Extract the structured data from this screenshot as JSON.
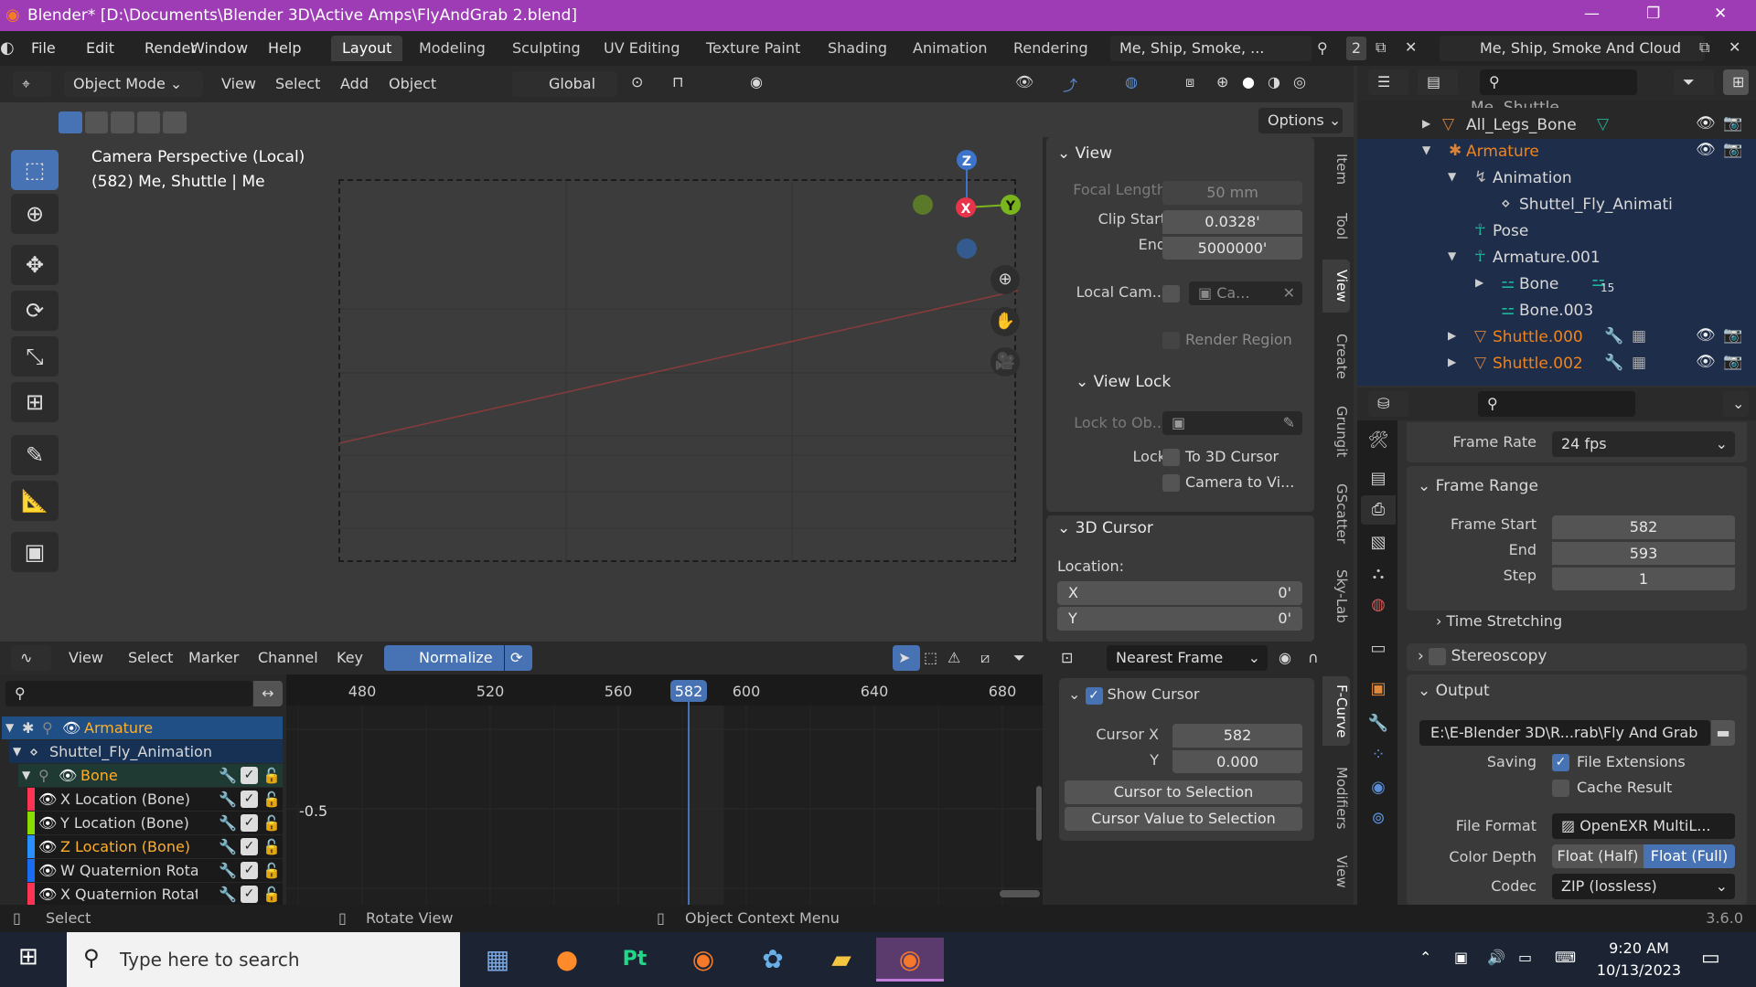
{
  "window": {
    "title": "Blender* [D:\\Documents\\Blender 3D\\Active Amps\\FlyAndGrab 2.blend]",
    "minimize": "—",
    "maximize": "❐",
    "close": "✕"
  },
  "menus": [
    "File",
    "Edit",
    "Render",
    "Window",
    "Help"
  ],
  "workspaces": [
    {
      "label": "Layout",
      "active": true
    },
    {
      "label": "Modeling"
    },
    {
      "label": "Sculpting"
    },
    {
      "label": "UV Editing"
    },
    {
      "label": "Texture Paint"
    },
    {
      "label": "Shading"
    },
    {
      "label": "Animation"
    },
    {
      "label": "Rendering"
    }
  ],
  "scene": {
    "name": "Me, Ship, Smoke, ...",
    "users": "2",
    "view_layer": "Me, Ship, Smoke And Cloud"
  },
  "viewport": {
    "mode": "Object Mode",
    "menus": [
      "View",
      "Select",
      "Add",
      "Object"
    ],
    "orientation": "Global",
    "options": "Options",
    "overlay_title": "Camera Perspective (Local)",
    "overlay_sub": "(582) Me, Shuttle | Me",
    "gizmo": {
      "x": "X",
      "y": "Y",
      "z": "Z"
    }
  },
  "tools": [
    "select-box",
    "cursor",
    "move",
    "rotate",
    "scale",
    "transform",
    "annotate",
    "measure",
    "add-cube"
  ],
  "npanel": {
    "view_title": "View",
    "focal_label": "Focal Length",
    "focal": "50 mm",
    "clip_start_label": "Clip Start",
    "clip_start": "0.0328'",
    "end_label": "End",
    "clip_end": "5000000'",
    "local_cam_label": "Local Cam...",
    "local_cam": "Ca...",
    "render_region": "Render Region",
    "view_lock": "View Lock",
    "lock_to_obj": "Lock to Ob...",
    "lock": "Lock",
    "to_cursor": "To 3D Cursor",
    "camera_to_view": "Camera to Vi...",
    "cursor_title": "3D Cursor",
    "location": "Location:",
    "x_label": "X",
    "x": "0'",
    "y_label": "Y",
    "y": "0'"
  },
  "vtabs": [
    {
      "label": "Item"
    },
    {
      "label": "Tool"
    },
    {
      "label": "View",
      "active": true
    },
    {
      "label": "Create"
    },
    {
      "label": "Grungit"
    },
    {
      "label": "GScatter"
    },
    {
      "label": "Sky-Lab"
    }
  ],
  "outliner": {
    "partial": "Me, Shuttle",
    "rows": [
      {
        "label": "All_Legs_Bone",
        "icon": "mesh",
        "color": "#d8d8d8"
      },
      {
        "label": "Armature",
        "icon": "armature",
        "color": "#f0841c"
      },
      {
        "label": "Animation",
        "icon": "animation",
        "color": "#d8d8d8"
      },
      {
        "label": "Shuttel_Fly_Animati",
        "icon": "action",
        "color": "#d8d8d8"
      },
      {
        "label": "Pose",
        "icon": "pose",
        "color": "#d8d8d8"
      },
      {
        "label": "Armature.001",
        "icon": "armature-data",
        "color": "#d8d8d8"
      },
      {
        "label": "Bone",
        "icon": "bone",
        "color": "#d8d8d8",
        "badge": "15"
      },
      {
        "label": "Bone.003",
        "icon": "bone",
        "color": "#d8d8d8"
      },
      {
        "label": "Shuttle.000",
        "icon": "mesh",
        "color": "#f0841c"
      },
      {
        "label": "Shuttle.002",
        "icon": "mesh",
        "color": "#f0841c"
      }
    ]
  },
  "props": {
    "frame_rate_label": "Frame Rate",
    "frame_rate": "24 fps",
    "frame_range": "Frame Range",
    "frame_start_label": "Frame Start",
    "frame_start": "582",
    "end_label": "End",
    "frame_end": "593",
    "step_label": "Step",
    "step": "1",
    "time_stretching": "Time Stretching",
    "stereoscopy": "Stereoscopy",
    "output": "Output",
    "path": "E:\\E-Blender 3D\\R...rab\\Fly And Grab",
    "saving_label": "Saving",
    "file_ext": "File Extensions",
    "cache": "Cache Result",
    "file_format_label": "File Format",
    "file_format": "OpenEXR MultiL...",
    "color_depth_label": "Color Depth",
    "depth_half": "Float (Half)",
    "depth_full": "Float (Full)",
    "codec_label": "Codec",
    "codec": "ZIP (lossless)"
  },
  "graph": {
    "menus": [
      "View",
      "Select",
      "Marker",
      "Channel",
      "Key"
    ],
    "normalize": "Normalize",
    "snap": "Nearest Frame",
    "frames": [
      "480",
      "520",
      "560",
      "600",
      "640",
      "680"
    ],
    "current_frame": "582",
    "ylabel": "-0.5",
    "channels": [
      {
        "label": "Armature",
        "type": "object",
        "color": "#ffaf29"
      },
      {
        "label": "Shuttel_Fly_Animation",
        "type": "action",
        "color": "#d8d8d8"
      },
      {
        "label": "Bone",
        "type": "group",
        "color": "#ffaf29"
      },
      {
        "label": "X Location (Bone)",
        "swatch": "#ff3352",
        "color": "#d8d8d8"
      },
      {
        "label": "Y Location (Bone)",
        "swatch": "#8bdc00",
        "color": "#d8d8d8"
      },
      {
        "label": "Z Location (Bone)",
        "swatch": "#2890ff",
        "color": "#ffaf29"
      },
      {
        "label": "W Quaternion Rota",
        "swatch": "#1a6cf0",
        "color": "#d8d8d8"
      },
      {
        "label": "X Quaternion Rotat",
        "swatch": "#ff3352",
        "color": "#d8d8d8"
      }
    ],
    "sidebar": {
      "show_cursor": "Show Cursor",
      "cursor_x_label": "Cursor X",
      "cursor_x": "582",
      "y_label": "Y",
      "cursor_y": "0.000",
      "to_selection": "Cursor to Selection",
      "value_to_selection": "Cursor Value to Selection"
    },
    "vtabs": [
      "F-Curve",
      "Modifiers",
      "View"
    ]
  },
  "status": {
    "select": "Select",
    "rotate": "Rotate View",
    "context": "Object Context Menu",
    "version": "3.6.0"
  },
  "taskbar": {
    "search": "Type here to search",
    "time": "9:20 AM",
    "date": "10/13/2023"
  },
  "colors": {
    "accent": "#4772b3",
    "title": "#9d3cb5",
    "selected": "#f0841c"
  }
}
